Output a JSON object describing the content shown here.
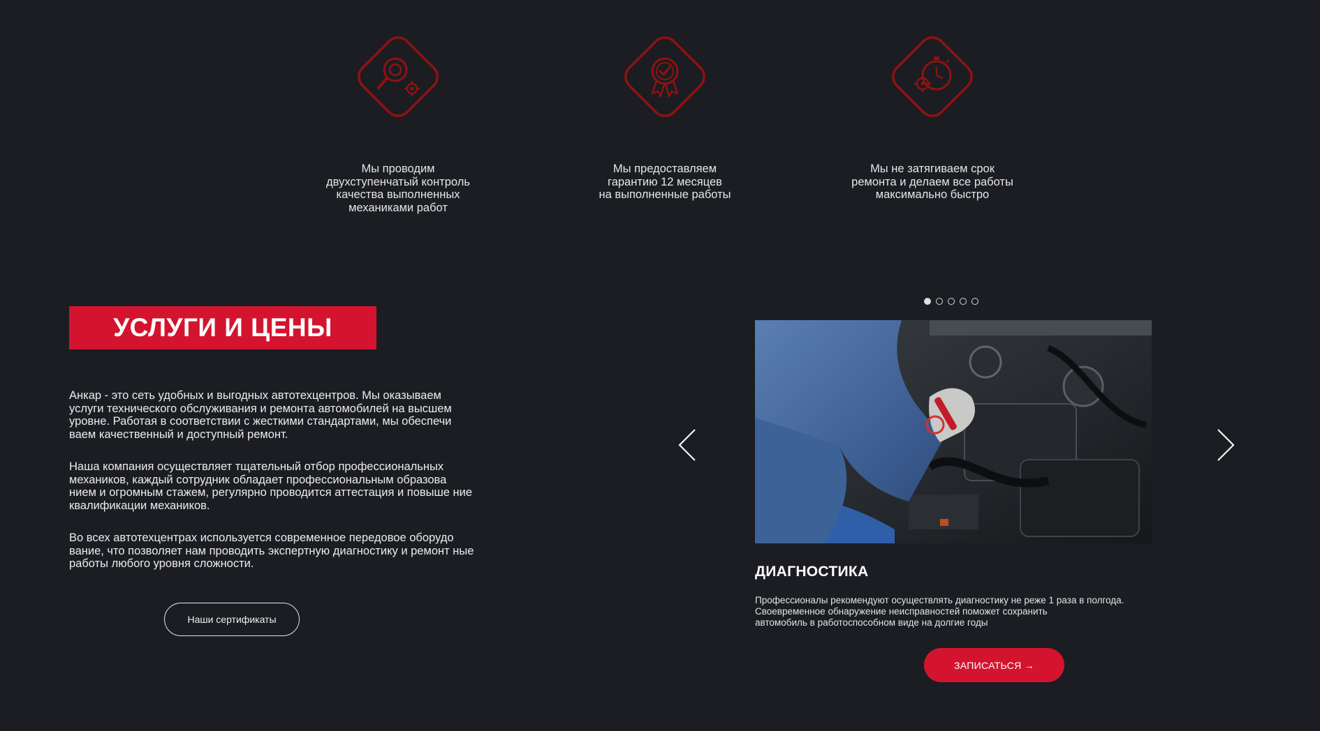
{
  "features": [
    {
      "icon": "magnifier-gears-icon",
      "text": "Мы проводим\nдвухступенчатый контроль\nкачества выполненных\nмеханиками работ"
    },
    {
      "icon": "award-badge-icon",
      "text": "Мы предоставляем\nгарантию 12 месяцев\nна выполненные работы"
    },
    {
      "icon": "stopwatch-gear-icon",
      "text": "Мы не затягиваем срок\nремонта и делаем все работы\nмаксимально быстро"
    }
  ],
  "services": {
    "title": "УСЛУГИ И ЦЕНЫ",
    "paragraphs": [
      "Анкар - это сеть удобных и выгодных автотехцентров. Мы оказываем услуги технического обслуживания и ремонта автомобилей на высшем уровне. Работая в соответствии с жесткими стандартами, мы обеспечи ваем качественный и доступный ремонт.",
      "Наша компания осуществляет тщательный отбор профессиональных механиков, каждый сотрудник обладает профессиональным образова нием и огромным стажем, регулярно проводится аттестация и повыше ние квалификации механиков.",
      "Во всех автотехцентрах используется современное передовое оборудо вание, что позволяет нам проводить экспертную диагностику и ремонт ные работы любого уровня сложности."
    ],
    "certificates_label": "Наши сертификаты"
  },
  "slider": {
    "dots_total": 5,
    "active_dot": 1,
    "slide": {
      "title": "ДИАГНОСТИКА",
      "text": "Профессионалы рекомендуют осуществлять диагностику не реже 1 раза в полгода.\nСвоевременное обнаружение неисправностей поможет сохранить\nавтомобиль в работоспособном виде на долгие годы",
      "button_label": "ЗАПИСАТЬСЯ →"
    }
  },
  "colors": {
    "background": "#1b1d22",
    "accent": "#d4142f",
    "icon_stroke": "#8f1212"
  }
}
